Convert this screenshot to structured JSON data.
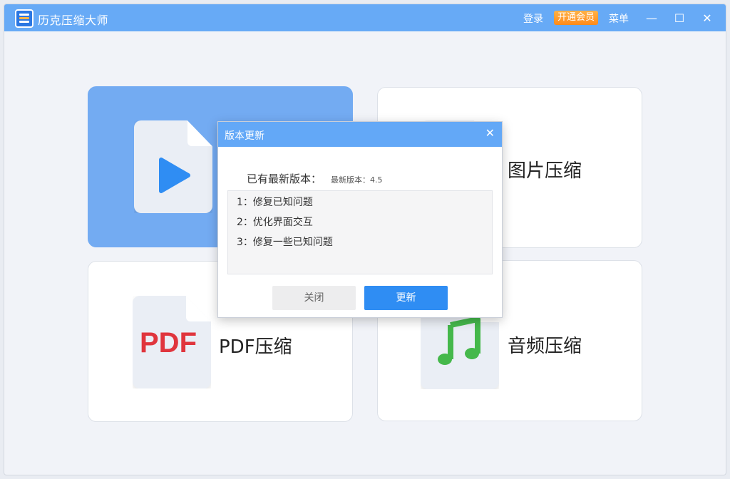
{
  "window": {
    "title": "历克压缩大师"
  },
  "titlebar": {
    "login": "登录",
    "vip": "开通会员",
    "menu": "菜单",
    "minimize": "—",
    "maximize": "☐",
    "close": "✕"
  },
  "cards": [
    {
      "label": ""
    },
    {
      "label": "图片压缩"
    },
    {
      "label": "PDF压缩",
      "icon_text": "PDF"
    },
    {
      "label": "音频压缩",
      "icon": "music-note-icon"
    }
  ],
  "dialog": {
    "title": "版本更新",
    "close": "✕",
    "latest_label": "已有最新版本：",
    "version_text": "最新版本：4.5",
    "notes": [
      "1：修复已知问题",
      "2：优化界面交互",
      "3：修复一些已知问题"
    ],
    "close_button": "关闭",
    "update_button": "更新"
  },
  "colors": {
    "titlebar": "#67aaf6",
    "accent": "#2f8df3",
    "vip": "#ff8a1a"
  }
}
